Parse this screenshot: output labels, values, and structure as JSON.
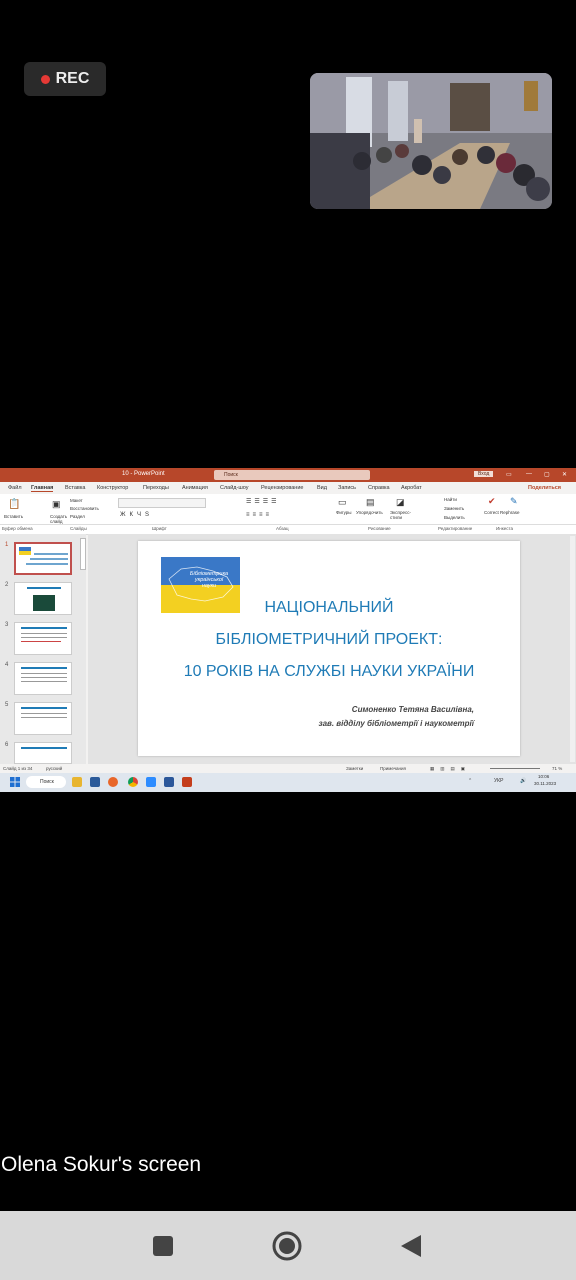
{
  "rec": {
    "label": "REC"
  },
  "caption": "Olena Sokur's screen",
  "ppt": {
    "window_title": "10 - PowerPoint",
    "search_placeholder": "Поиск",
    "sign_in": "Вход",
    "share": "Поделиться",
    "tabs": [
      "Файл",
      "Главная",
      "Вставка",
      "Конструктор",
      "Переходы",
      "Анимация",
      "Слайд-шоу",
      "Рецензирование",
      "Вид",
      "Запись",
      "Справка",
      "Акробат"
    ],
    "ribbon": {
      "paste": "Вставить",
      "new_slide": "Создать слайд",
      "layout": "Макет",
      "reset": "Восстановить",
      "section": "Раздел",
      "shapes": "Фигуры",
      "arrange": "Упорядочить",
      "quick_styles": "Экспресс-стили",
      "find": "Найти",
      "replace": "Заменить",
      "select": "Выделить",
      "correct_rephrase": "Correct Rephrase",
      "groups": [
        "Буфер обмена",
        "Слайды",
        "Шрифт",
        "Абзац",
        "Рисование",
        "Редактирование",
        "Инкеста"
      ]
    },
    "thumb_numbers": [
      "1",
      "2",
      "3",
      "4",
      "5",
      "6"
    ],
    "slide": {
      "flag_text": "Бібліометрика української науки",
      "line1": "НАЦІОНАЛЬНИЙ",
      "line2": "БІБЛІОМЕТРИЧНИЙ ПРОЕКТ:",
      "line3": "10 РОКІВ НА СЛУЖБІ НАУКИ УКРАЇНИ",
      "author": "Симоненко Тетяна Василівна,",
      "position": "зав. відділу бібліометрії і наукометрії"
    },
    "status": {
      "slide_count": "Слайд 1 из 34",
      "language": "русский",
      "notes": "Заметки",
      "comments": "Примечания",
      "zoom": "71 %"
    }
  },
  "taskbar": {
    "search": "Поиск",
    "lang": "УКР",
    "time": "10:06",
    "date": "30.11.2023"
  },
  "colors": {
    "ppt_accent": "#b7472a",
    "slide_title": "#1f7bb6"
  }
}
